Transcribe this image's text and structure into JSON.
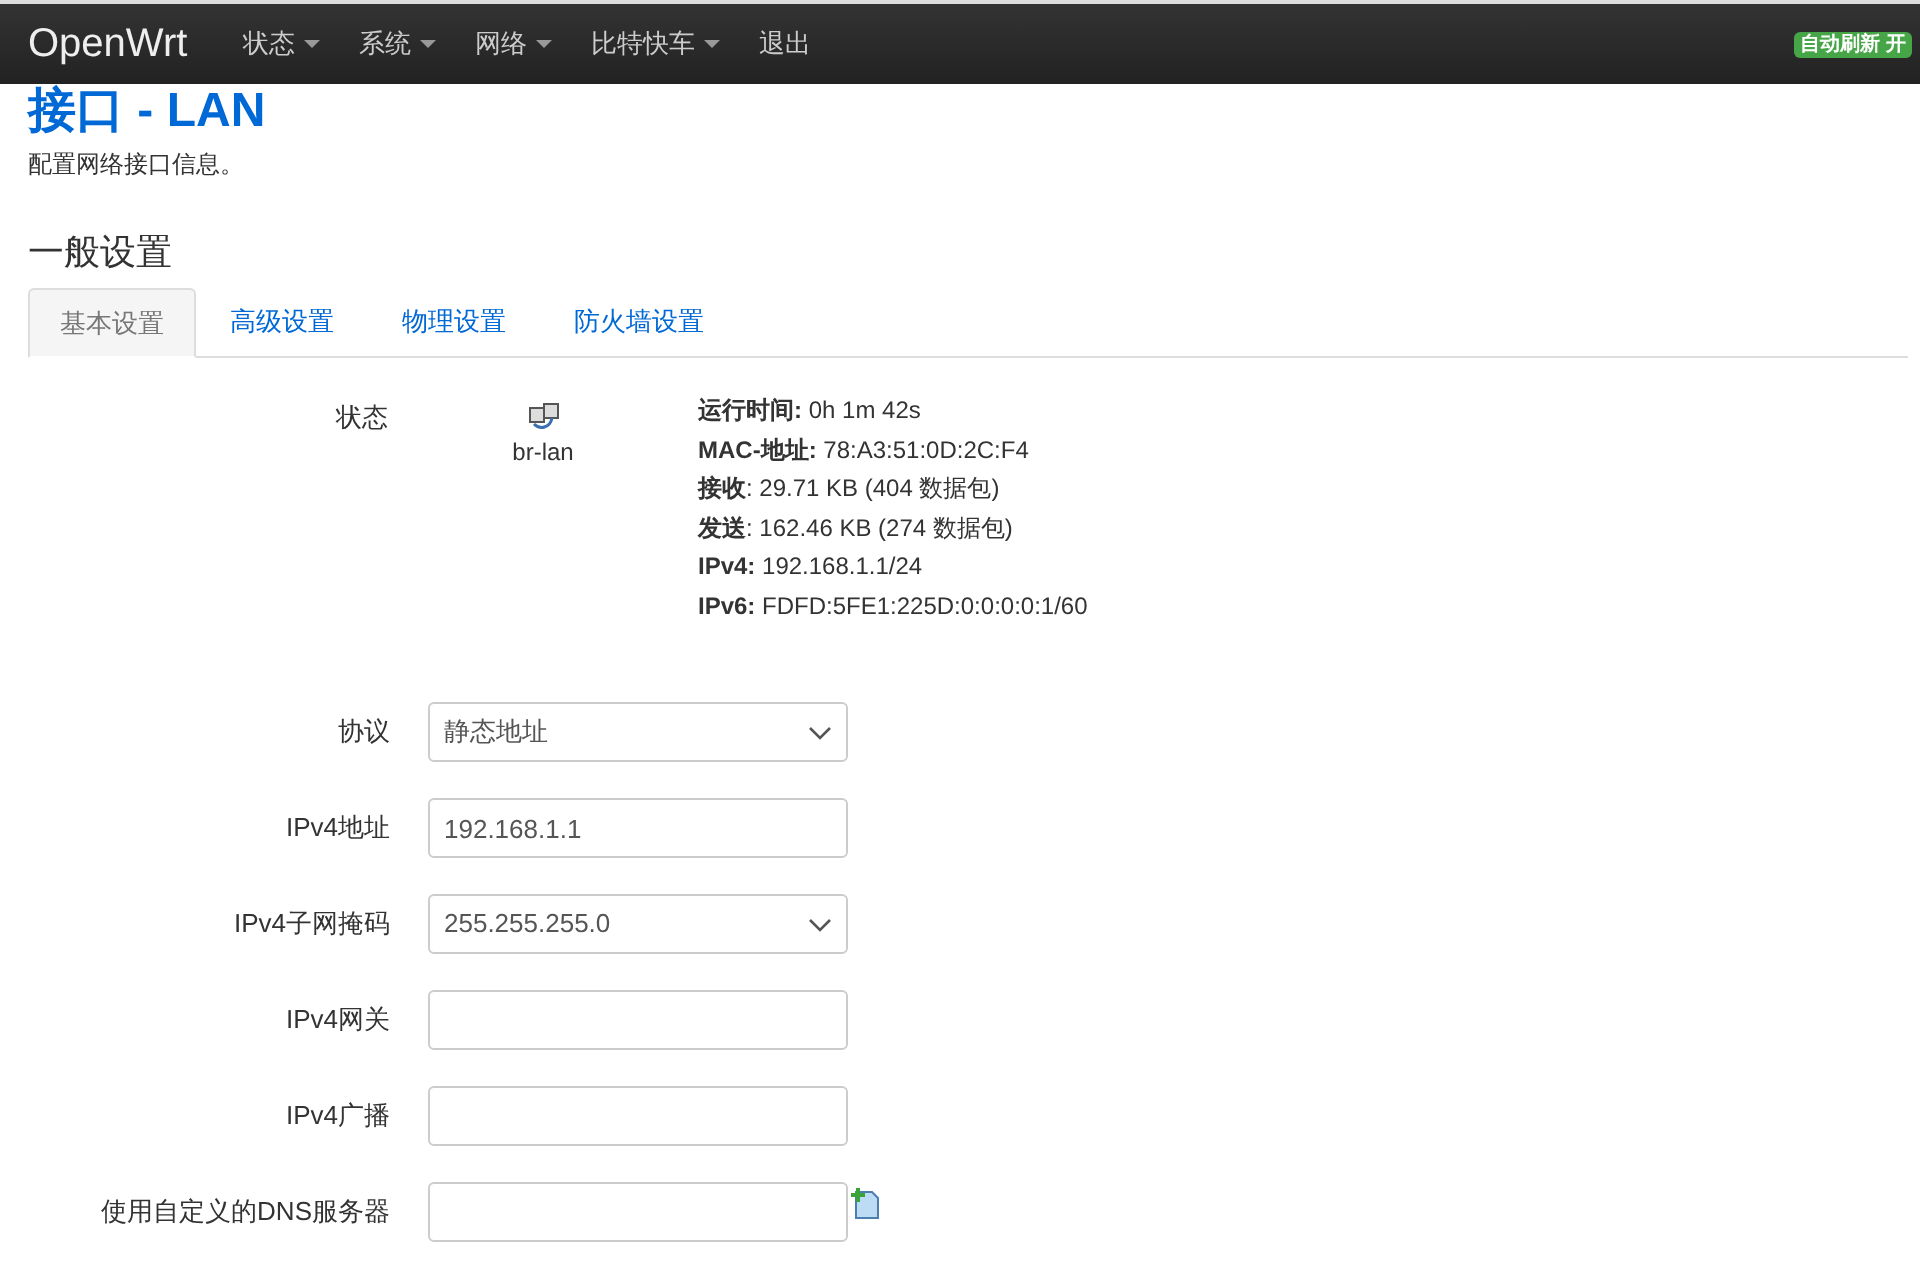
{
  "navbar": {
    "brand": "OpenWrt",
    "menu": [
      {
        "label": "状态",
        "dropdown": true
      },
      {
        "label": "系统",
        "dropdown": true
      },
      {
        "label": "网络",
        "dropdown": true
      },
      {
        "label": "比特快车",
        "dropdown": true
      },
      {
        "label": "退出",
        "dropdown": false
      }
    ],
    "badge": "自动刷新 开"
  },
  "title": "接口 - LAN",
  "description": "配置网络接口信息。",
  "section_title": "一般设置",
  "tabs": [
    {
      "label": "基本设置",
      "selected": true
    },
    {
      "label": "高级设置",
      "selected": false
    },
    {
      "label": "物理设置",
      "selected": false
    },
    {
      "label": "防火墙设置",
      "selected": false
    }
  ],
  "status": {
    "label": "状态",
    "device": "br-lan",
    "lines": [
      "**运行时间:** 0h 1m 42s",
      "**MAC-地址:** 78:A3:51:0D:2C:F4",
      "**接收**: 29.71 KB (404 数据包)",
      "**发送**: 162.46 KB (274 数据包)",
      "**IPv4:** 192.168.1.1/24",
      "**IPv6:** FDFD:5FE1:225D:0:0:0:0:1/60"
    ]
  },
  "fields": [
    {
      "kind": "select",
      "label": "协议",
      "value": "静态地址"
    },
    {
      "kind": "text",
      "label": "IPv4地址",
      "value": "192.168.1.1"
    },
    {
      "kind": "select",
      "label": "IPv4子网掩码",
      "value": "255.255.255.0"
    },
    {
      "kind": "text",
      "label": "IPv4网关"
    },
    {
      "kind": "text",
      "label": "IPv4广播"
    },
    {
      "kind": "list",
      "label": "使用自定义的DNS服务器"
    }
  ]
}
